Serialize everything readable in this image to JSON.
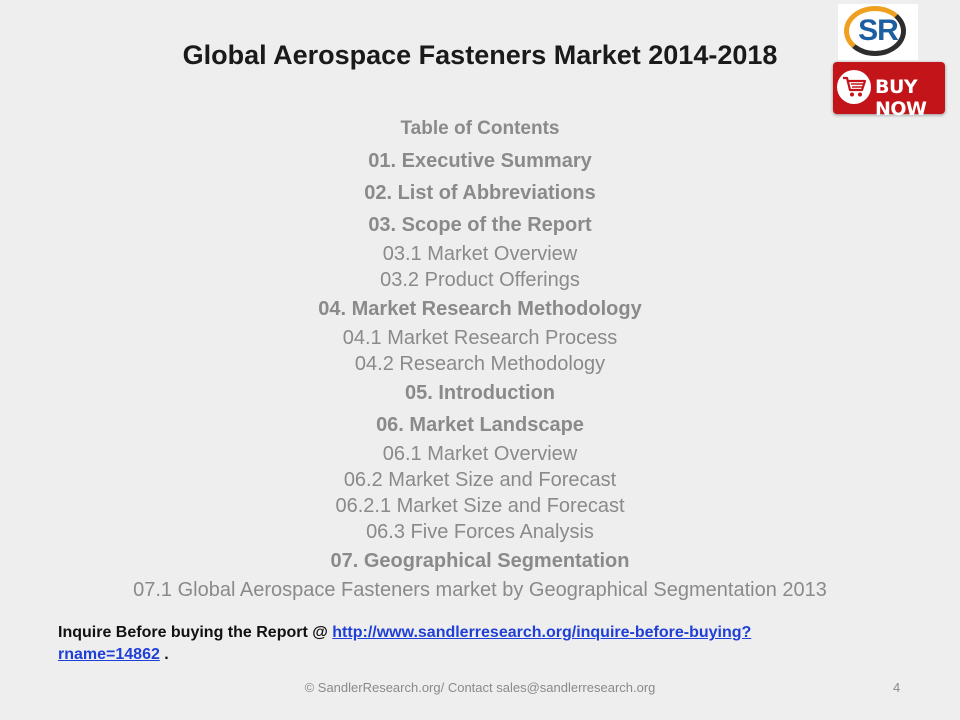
{
  "slide": {
    "title": "Global Aerospace Fasteners Market 2014-2018",
    "logo_text": "SR",
    "buy_label": "BUY NOW",
    "toc": [
      {
        "text": "Table of Contents",
        "kind": "toc-title"
      },
      {
        "text": "01. Executive Summary",
        "kind": "heading"
      },
      {
        "text": "02. List of Abbreviations",
        "kind": "heading"
      },
      {
        "text": "03. Scope of the Report",
        "kind": "heading"
      },
      {
        "text": "03.1 Market Overview",
        "kind": "sub"
      },
      {
        "text": "03.2 Product Offerings",
        "kind": "sub"
      },
      {
        "text": "04. Market Research Methodology",
        "kind": "heading"
      },
      {
        "text": "04.1 Market Research Process",
        "kind": "sub"
      },
      {
        "text": "04.2 Research Methodology",
        "kind": "sub"
      },
      {
        "text": "05. Introduction",
        "kind": "heading"
      },
      {
        "text": "06. Market Landscape",
        "kind": "heading"
      },
      {
        "text": "06.1 Market Overview",
        "kind": "sub"
      },
      {
        "text": "06.2 Market Size and Forecast",
        "kind": "sub"
      },
      {
        "text": "06.2.1 Market Size and Forecast",
        "kind": "sub"
      },
      {
        "text": "06.3 Five Forces Analysis",
        "kind": "sub"
      },
      {
        "text": "07. Geographical Segmentation",
        "kind": "heading"
      },
      {
        "text": "07.1 Global Aerospace Fasteners market by Geographical Segmentation 2013",
        "kind": "sub"
      }
    ],
    "inquire": {
      "prefix": "Inquire Before buying the Report @ ",
      "link_text": "http://www.sandlerresearch.org/inquire-before-buying?rname=14862",
      "suffix": " ."
    },
    "footer": "© SandlerResearch.org/ Contact  sales@sandlerresearch.org",
    "page_number": "4"
  },
  "colors": {
    "background": "#eeeeee",
    "toc_text": "#8a8a8a",
    "link": "#1f3fd6",
    "buy_button": "#c3141a",
    "logo_orange": "#f0a020",
    "logo_blue": "#1b5fa0"
  }
}
